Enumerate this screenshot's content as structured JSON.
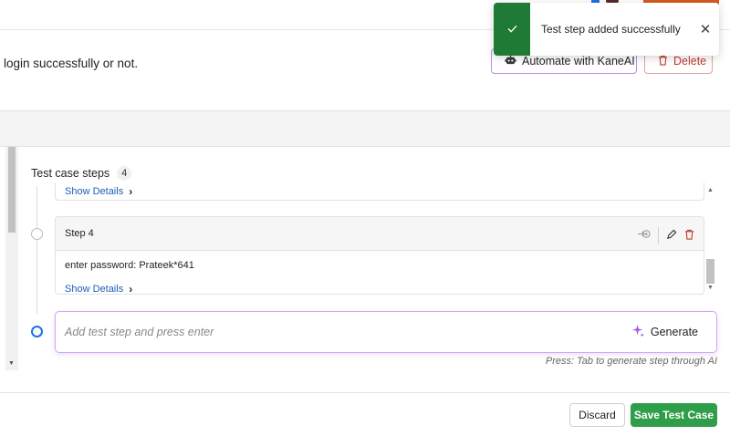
{
  "header": {
    "description": "login successfully or not.",
    "automate_label": "Automate with KaneAI",
    "delete_label": "Delete"
  },
  "steps_section": {
    "title": "Test case steps",
    "count": "4",
    "previous_card": {
      "show_details": "Show Details"
    },
    "step_card": {
      "title": "Step 4",
      "text": "enter password: Prateek*641",
      "show_details": "Show Details"
    },
    "add_step": {
      "placeholder": "Add test step and press enter",
      "generate_label": "Generate",
      "hint": "Press: Tab to generate step through AI"
    }
  },
  "footer": {
    "discard_label": "Discard",
    "save_label": "Save Test Case"
  },
  "toast": {
    "message": "Test step added successfully"
  },
  "icons": {
    "toast_status": "check-icon",
    "toast_close": "close-icon",
    "automate": "robot-icon",
    "delete": "trash-icon",
    "step_navigate": "navigate-icon",
    "step_edit": "pencil-icon",
    "step_delete": "trash-icon",
    "generate": "sparkle-icon",
    "show_details": "chevron-right-icon"
  },
  "colors": {
    "primary_green": "#2e9e4a",
    "toast_green": "#1e7a34",
    "accent_purple": "#b58ce8",
    "link_blue": "#1a5fb4",
    "danger_red": "#c0392b"
  }
}
